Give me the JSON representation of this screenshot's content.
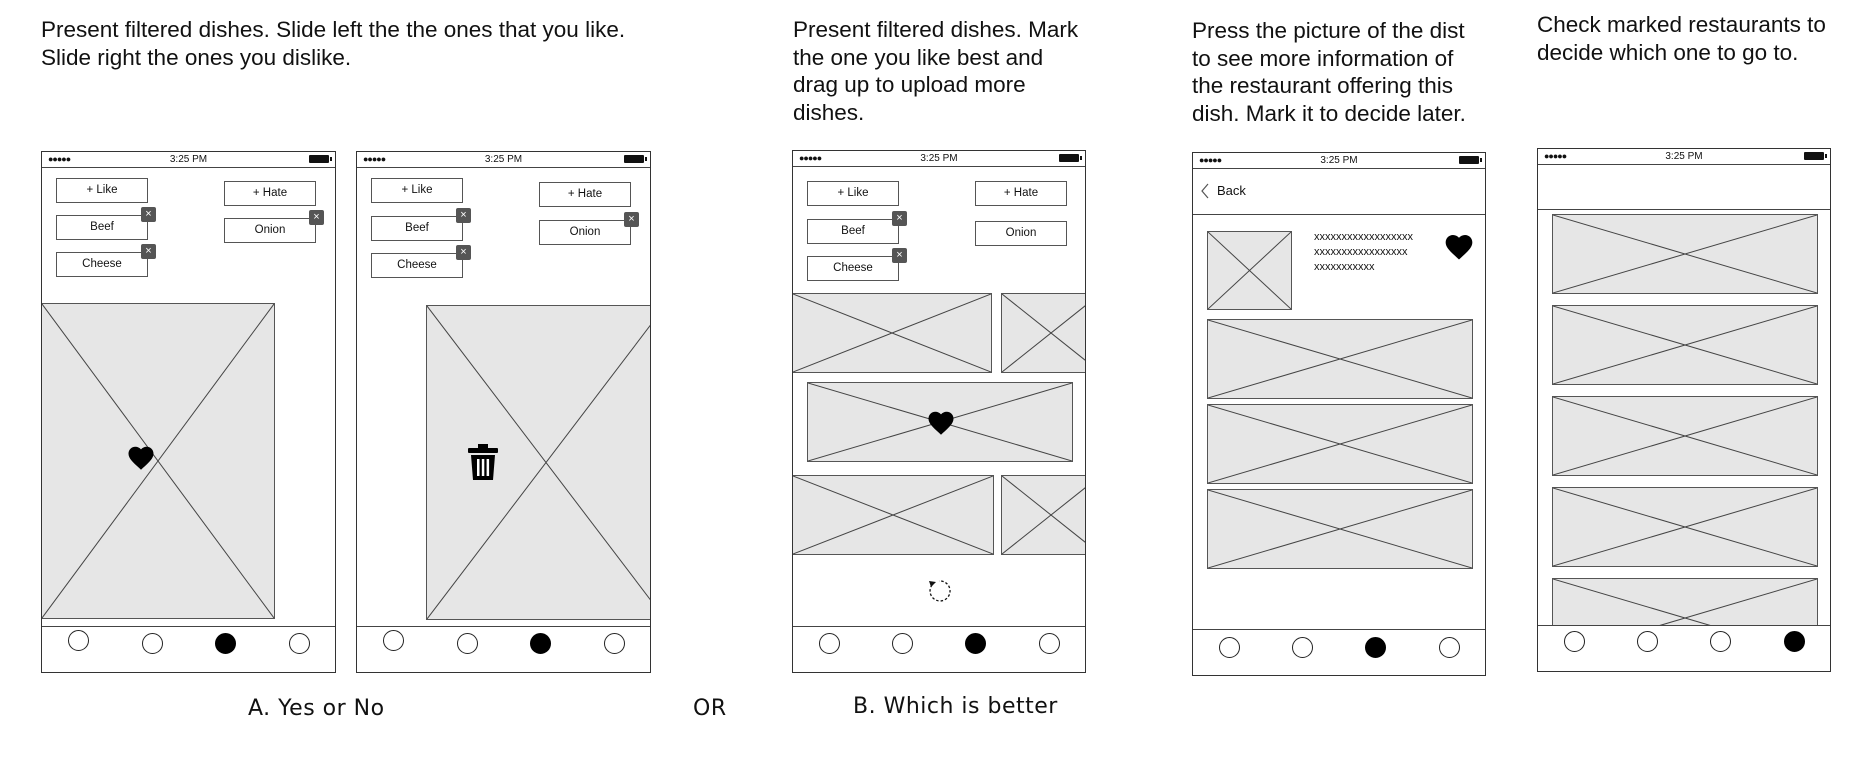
{
  "captions": {
    "a": "Present filtered dishes. Slide left the the ones that you like.\nSlide right the ones you dislike.",
    "b": "Present filtered dishes. Mark\nthe one you like best and\ndrag up to upload more\ndishes.",
    "c": "Press the picture of the dist\nto see more information of\nthe restaurant offering this\ndish. Mark it to decide later.",
    "d": "Check marked restaurants to\ndecide which one to go to."
  },
  "labels": {
    "a": "A. Yes or No",
    "or": "OR",
    "b": "B. Which is better"
  },
  "status": {
    "signal": "●●●●●",
    "time": "3:25 PM"
  },
  "filters": {
    "like_button": "+   Like",
    "hate_button": "+   Hate",
    "beef": "Beef",
    "cheese": "Cheese",
    "onion": "Onion",
    "remove": "×"
  },
  "detail": {
    "back": "Back",
    "text_lines": [
      "xxxxxxxxxxxxxxxxxx",
      "xxxxxxxxxxxxxxxxx",
      "xxxxxxxxxxx"
    ]
  },
  "icons": {
    "heart": "heart-icon",
    "trash": "trash-icon",
    "reload": "reload-icon",
    "back": "chevron-left-icon"
  }
}
